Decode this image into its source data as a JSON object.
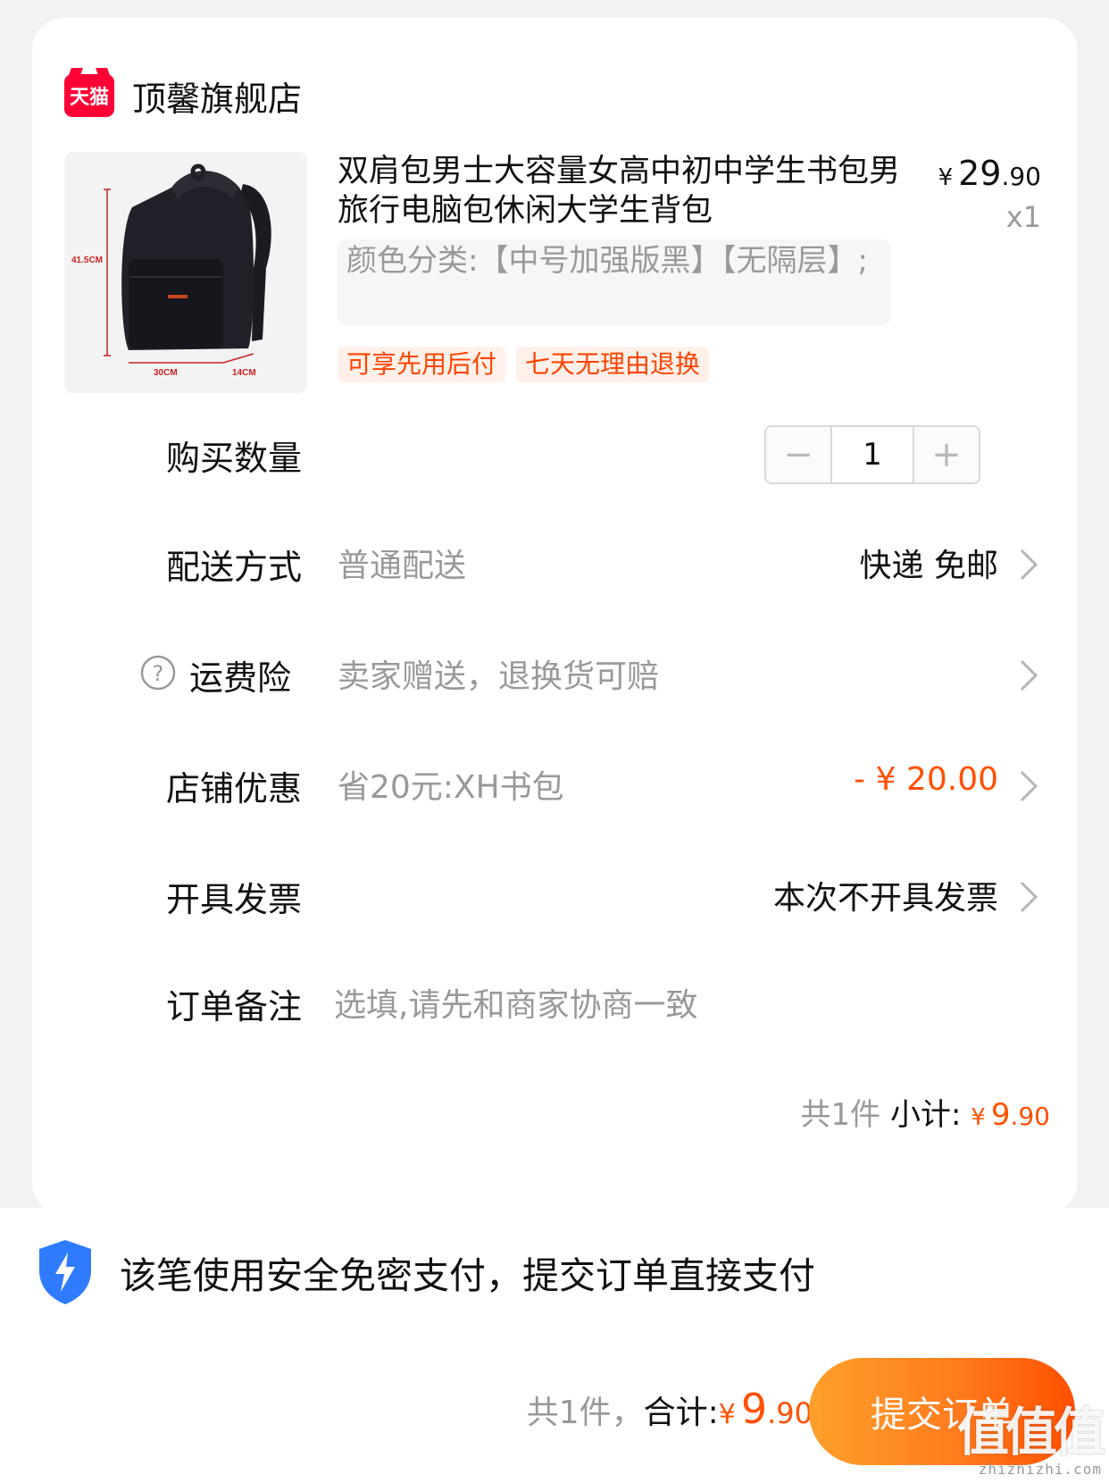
{
  "shop": {
    "badge_text": "天猫",
    "name": "顶馨旗舰店",
    "badge_color": "#ff0036"
  },
  "product": {
    "title": "双肩包男士大容量女高中初中学生书包男旅行电脑包休闲大学生背包",
    "sku": "颜色分类:【中号加强版黑】【无隔层】;",
    "price_currency": "¥",
    "price_int": "29",
    "price_dec": ".90",
    "quantity_label": "x1",
    "tags": [
      "可享先用后付",
      "七天无理由退换"
    ],
    "image": {
      "height_label": "41.5CM",
      "width_label": "30CM",
      "depth_label": "14CM",
      "icon": "backpack-image"
    }
  },
  "quantity_row": {
    "label": "购买数量",
    "minus": "−",
    "value": "1",
    "plus": "+"
  },
  "delivery_row": {
    "label": "配送方式",
    "sub": "普通配送",
    "value": "快递 免邮"
  },
  "insurance_row": {
    "label": "运费险",
    "sub": "卖家赠送，退换货可赔"
  },
  "coupon_row": {
    "label": "店铺优惠",
    "sub": "省20元:XH书包",
    "value": "- ¥ 20.00"
  },
  "invoice_row": {
    "label": "开具发票",
    "value": "本次不开具发票"
  },
  "note_row": {
    "label": "订单备注",
    "placeholder": "选填,请先和商家协商一致"
  },
  "subtotal": {
    "count_text": "共1件",
    "label": "小计:",
    "currency": "¥",
    "int": "9",
    "dec": ".90"
  },
  "bottom_bar": {
    "secure_text": "该笔使用安全免密支付，提交订单直接支付",
    "count_text": "共1件，",
    "total_label": "合计:",
    "currency": "¥",
    "total_int": "9",
    "total_dec": ".90",
    "submit_label": "提交订单"
  },
  "watermark": {
    "glyphs": "值值值",
    "url": "zhizhizhi.com"
  },
  "colors": {
    "accent": "#ff5000",
    "submit_gradient": [
      "#ffa02a",
      "#ff5000"
    ],
    "shield": "#2f7bff"
  }
}
